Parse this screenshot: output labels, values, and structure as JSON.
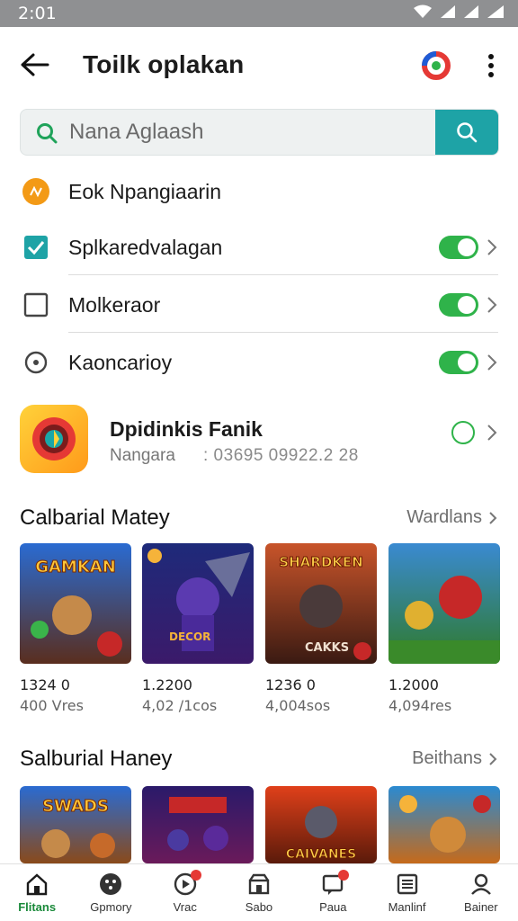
{
  "status": {
    "time": "2:01"
  },
  "header": {
    "title": "Toilk oplakan",
    "back": "back",
    "brand_icon": "app-brand-icon",
    "menu": "more-vert-icon"
  },
  "search": {
    "placeholder": "Nana Aglaash",
    "value": ""
  },
  "settings": [
    {
      "label": "Eok Npangiaarin",
      "icon": "orange-badge-icon",
      "toggle": null
    },
    {
      "label": "Splkaredvalagan",
      "icon": "checkbox-checked-icon",
      "toggle": true
    },
    {
      "label": "Molkeraor",
      "icon": "checkbox-empty-icon",
      "toggle": true
    },
    {
      "label": "Kaoncarioy",
      "icon": "radio-dot-icon",
      "toggle": true
    }
  ],
  "app": {
    "name": "Dpidinkis Fanik",
    "sub_label": "Nangara",
    "sub_value": ": 03695  09922.2 28"
  },
  "section1": {
    "title": "Calbarial Matey",
    "link": "Wardlans",
    "tiles": [
      {
        "price": "1324 0",
        "meta": "400 Vres"
      },
      {
        "price": "1.2200",
        "meta": "4,02 /1cos"
      },
      {
        "price": "1236 0",
        "meta": "4,004sos"
      },
      {
        "price": "1.2000",
        "meta": "4,094res"
      }
    ]
  },
  "section2": {
    "title": "Salburial Haney",
    "link": "Beithans"
  },
  "nav": [
    {
      "label": "Flitans"
    },
    {
      "label": "Gpmory"
    },
    {
      "label": "Vrac"
    },
    {
      "label": "Sabo"
    },
    {
      "label": "Paua"
    },
    {
      "label": "Manlinf"
    },
    {
      "label": "Bainer"
    }
  ],
  "colors": {
    "accent": "#1ea3a6",
    "toggle": "#2fb34a",
    "statusbar": "#8f9092",
    "nav_active": "#1a8a3a"
  }
}
